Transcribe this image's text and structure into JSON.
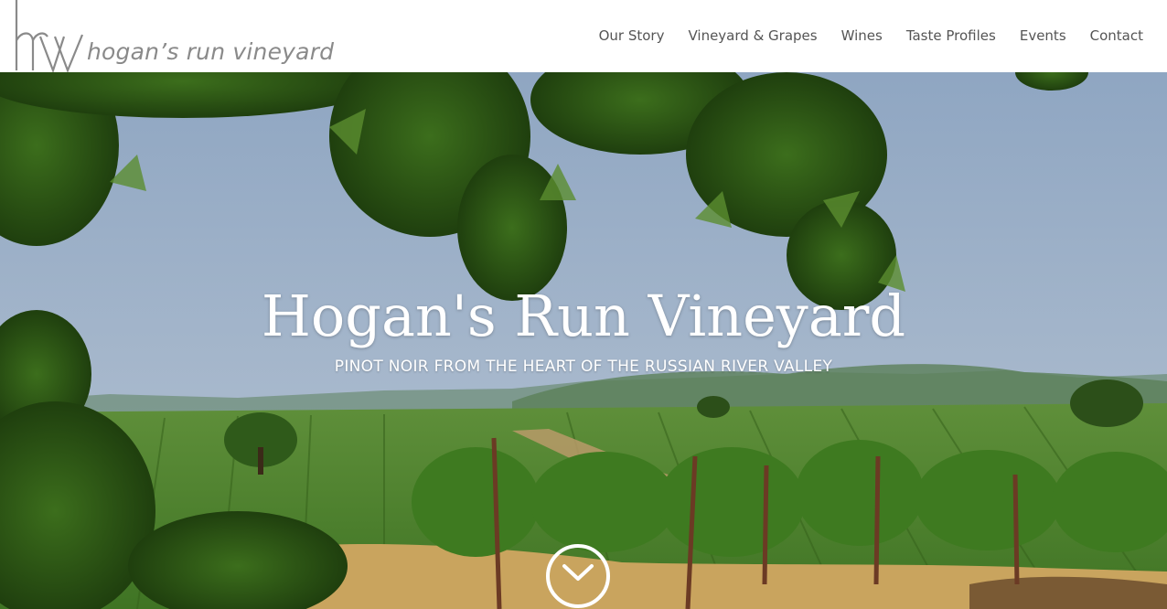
{
  "header": {
    "logo": {
      "monogram": "hrv",
      "text": "hogan’s run vineyard"
    },
    "nav": [
      {
        "label": "Our Story"
      },
      {
        "label": "Vineyard & Grapes"
      },
      {
        "label": "Wines"
      },
      {
        "label": "Taste Profiles"
      },
      {
        "label": "Events"
      },
      {
        "label": "Contact"
      }
    ]
  },
  "hero": {
    "title": "Hogan's Run Vineyard",
    "subtitle": "PINOT NOIR FROM THE HEART OF THE RUSSIAN RIVER VALLEY",
    "scroll_icon": "chevron-down-icon"
  },
  "colors": {
    "logo_gray": "#8a8a8a",
    "nav_text": "#555555",
    "hero_text": "#ffffff",
    "sky": "#9bb0c8",
    "vineyard_green": "#4f8a2c",
    "soil": "#c9a45e"
  }
}
